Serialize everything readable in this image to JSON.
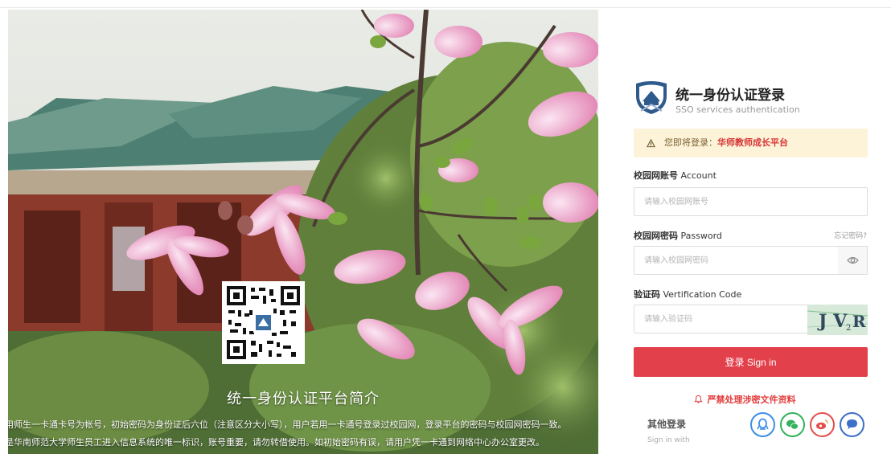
{
  "intro": {
    "title": "统一身份认证平台简介",
    "line1": "用师生一卡通卡号为帐号，初始密码为身份证后六位（注意区分大小写），用户若用一卡通号登录过校园网，登录平台的密码与校园网密码一致。",
    "line2": "是华南师范大学师生员工进入信息系统的唯一标识，账号重要，请勿转借使用。如初始密码有误，请用户凭一卡通到网络中心办公室更改。"
  },
  "login": {
    "title": "统一身份认证登录",
    "subtitle": "SSO services authentication",
    "notice_prefix": "您即将登录：",
    "notice_platform": "华师教师成长平台",
    "account_label_cn": "校园网账号",
    "account_label_en": " Account",
    "account_placeholder": "请输入校园网账号",
    "password_label_cn": "校园网密码",
    "password_label_en": " Password",
    "forgot": "忘记密码?",
    "password_placeholder": "请输入校园网密码",
    "code_label_cn": "验证码",
    "code_label_en": " Vertification Code",
    "code_placeholder": "请输入验证码",
    "captcha_text": "JV2R",
    "signin": "登录 Sign in",
    "alert": "严禁处理涉密文件资料",
    "other_title": "其他登录",
    "other_sub": "Sign in with"
  },
  "colors": {
    "accent": "#e2404b",
    "notice_bg": "#fdf3d8",
    "social_blue": "#3d8ee6",
    "social_green": "#34b15a",
    "social_red": "#e54d4d",
    "social_navy": "#3d6fc7"
  },
  "icons": [
    "warning-icon",
    "eye-icon",
    "bell-icon",
    "qq-icon",
    "wechat-icon",
    "weibo-icon",
    "chat-icon"
  ]
}
